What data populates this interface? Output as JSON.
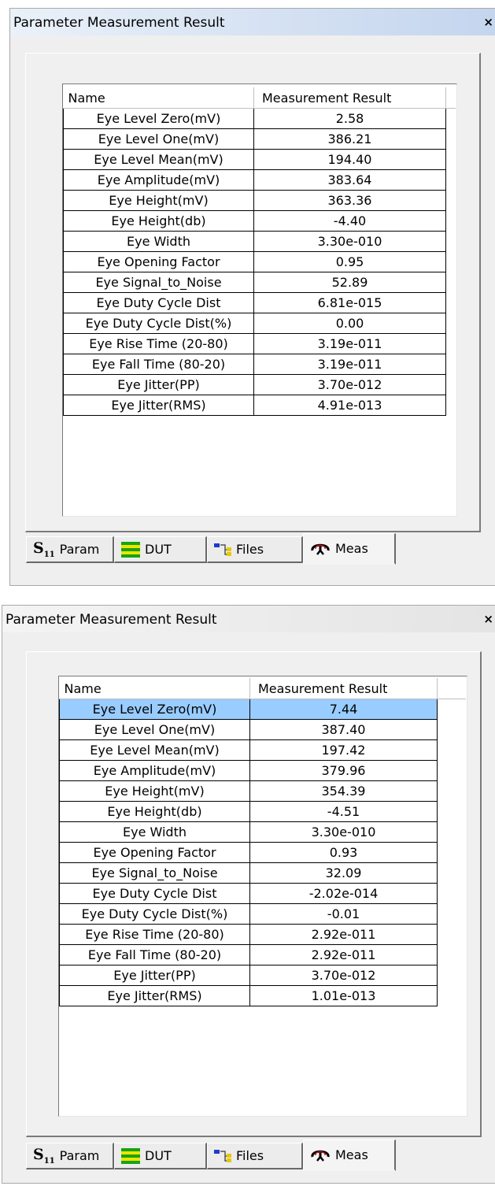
{
  "panels": [
    {
      "title": "Parameter Measurement Result",
      "close": "×",
      "columns": [
        "Name",
        "Measurement Result"
      ],
      "selected_row": -1,
      "rows": [
        {
          "name": "Eye Level Zero(mV)",
          "value": "2.58"
        },
        {
          "name": "Eye Level One(mV)",
          "value": "386.21"
        },
        {
          "name": "Eye Level Mean(mV)",
          "value": "194.40"
        },
        {
          "name": "Eye Amplitude(mV)",
          "value": "383.64"
        },
        {
          "name": "Eye Height(mV)",
          "value": "363.36"
        },
        {
          "name": "Eye Height(db)",
          "value": "-4.40"
        },
        {
          "name": "Eye Width",
          "value": "3.30e-010"
        },
        {
          "name": "Eye Opening Factor",
          "value": "0.95"
        },
        {
          "name": "Eye Signal_to_Noise",
          "value": "52.89"
        },
        {
          "name": "Eye Duty Cycle Dist",
          "value": "6.81e-015"
        },
        {
          "name": "Eye Duty Cycle Dist(%)",
          "value": "0.00"
        },
        {
          "name": "Eye Rise Time (20-80)",
          "value": "3.19e-011"
        },
        {
          "name": "Eye Fall Time (80-20)",
          "value": "3.19e-011"
        },
        {
          "name": "Eye Jitter(PP)",
          "value": "3.70e-012"
        },
        {
          "name": "Eye Jitter(RMS)",
          "value": "4.91e-013"
        }
      ],
      "tabs": [
        {
          "label": "Param",
          "icon": "s11-icon",
          "icon_text": "S",
          "icon_sub": "11"
        },
        {
          "label": "DUT",
          "icon": "dut-icon"
        },
        {
          "label": "Files",
          "icon": "files-icon"
        },
        {
          "label": "Meas",
          "icon": "meas-icon",
          "active": true
        }
      ]
    },
    {
      "title": "Parameter Measurement Result",
      "close": "×",
      "columns": [
        "Name",
        "Measurement Result"
      ],
      "selected_row": 0,
      "rows": [
        {
          "name": "Eye Level Zero(mV)",
          "value": "7.44"
        },
        {
          "name": "Eye Level One(mV)",
          "value": "387.40"
        },
        {
          "name": "Eye Level Mean(mV)",
          "value": "197.42"
        },
        {
          "name": "Eye Amplitude(mV)",
          "value": "379.96"
        },
        {
          "name": "Eye Height(mV)",
          "value": "354.39"
        },
        {
          "name": "Eye Height(db)",
          "value": "-4.51"
        },
        {
          "name": "Eye Width",
          "value": "3.30e-010"
        },
        {
          "name": "Eye Opening Factor",
          "value": "0.93"
        },
        {
          "name": "Eye Signal_to_Noise",
          "value": "32.09"
        },
        {
          "name": "Eye Duty Cycle Dist",
          "value": "-2.02e-014"
        },
        {
          "name": "Eye Duty Cycle Dist(%)",
          "value": "-0.01"
        },
        {
          "name": "Eye Rise Time (20-80)",
          "value": "2.92e-011"
        },
        {
          "name": "Eye Fall Time (80-20)",
          "value": "2.92e-011"
        },
        {
          "name": "Eye Jitter(PP)",
          "value": "3.70e-012"
        },
        {
          "name": "Eye Jitter(RMS)",
          "value": "1.01e-013"
        }
      ],
      "tabs": [
        {
          "label": "Param",
          "icon": "s11-icon",
          "icon_text": "S",
          "icon_sub": "11"
        },
        {
          "label": "DUT",
          "icon": "dut-icon"
        },
        {
          "label": "Files",
          "icon": "files-icon"
        },
        {
          "label": "Meas",
          "icon": "meas-icon",
          "active": true
        }
      ]
    }
  ],
  "colors": {
    "title_gradient_start": "#eaf1f9",
    "title_gradient_end": "#c7d7ef",
    "selected_row": "#99ccff",
    "dut_icon_green": "#14a514",
    "dut_icon_yellow": "#f2e200",
    "files_icon_blue": "#1c3ccc",
    "meas_icon_red": "#c4161c"
  }
}
